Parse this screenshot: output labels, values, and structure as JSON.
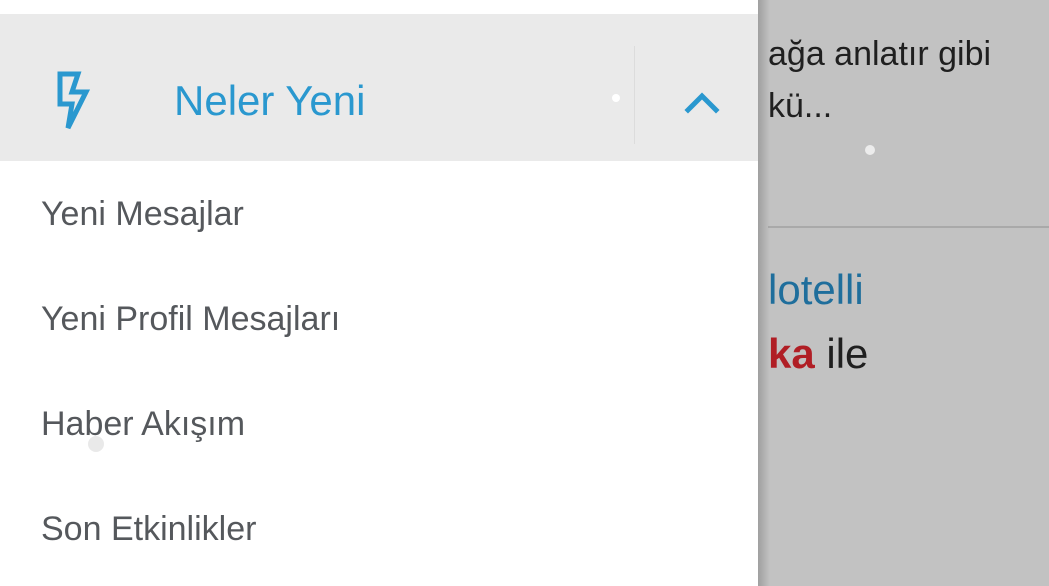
{
  "background": {
    "text_line1": "ağa anlatır gibi",
    "text_line2": "kü...",
    "link_text": "lotelli",
    "line_highlight": "ka",
    "line_rest": " ile"
  },
  "drawer": {
    "section": {
      "title": "Neler Yeni",
      "icon": "bolt-icon",
      "toggle_icon": "chevron-up-icon",
      "accent_color": "#2a98cf"
    },
    "items": [
      {
        "label": "Yeni Mesajlar"
      },
      {
        "label": "Yeni Profil Mesajları"
      },
      {
        "label": "Haber Akışım"
      },
      {
        "label": "Son Etkinlikler"
      }
    ]
  }
}
